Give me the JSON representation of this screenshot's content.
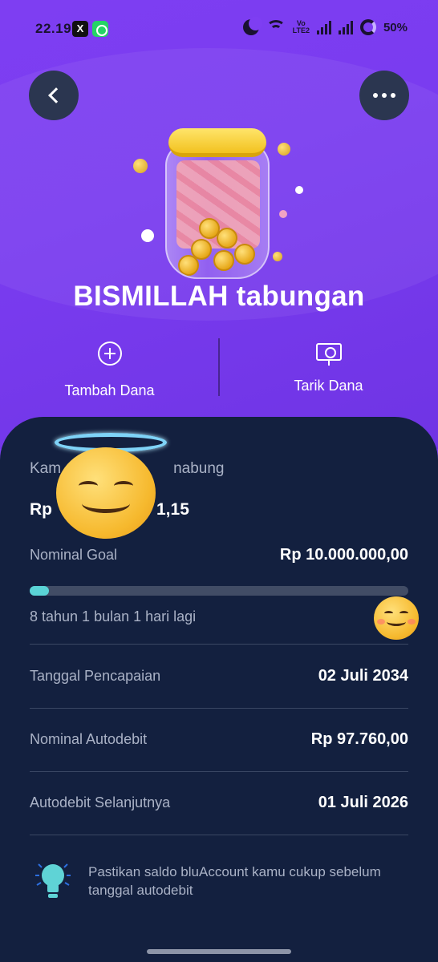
{
  "status_bar": {
    "time": "22.19",
    "app_icons": [
      "x-icon",
      "whatsapp-icon"
    ],
    "network_label_top": "Vo",
    "network_label_bottom": "LTE2",
    "battery": "50%"
  },
  "header": {
    "back_icon": "chevron-left-icon",
    "more_icon": "more-horizontal-icon",
    "jar_illustration": "savings-jar-icon",
    "title": "BISMILLAH tabungan"
  },
  "actions": [
    {
      "label": "Tambah Dana",
      "icon": "plus-circle-icon"
    },
    {
      "label": "Tarik Dana",
      "icon": "cash-withdraw-icon"
    }
  ],
  "card": {
    "saved_label_visible_start": "Kam",
    "saved_label_visible_end": "nabung",
    "saved_value_visible_start": "Rp",
    "saved_value_visible_end": "1,15",
    "goal_label": "Nominal Goal",
    "goal_value": "Rp 10.000.000,00",
    "progress_percent": 5,
    "remaining_text": "8 tahun 1 bulan 1 hari lagi",
    "details": [
      {
        "label": "Tanggal Pencapaian",
        "value": "02 Juli 2034"
      },
      {
        "label": "Nominal Autodebit",
        "value": "Rp 97.760,00"
      },
      {
        "label": "Autodebit Selanjutnya",
        "value": "01 Juli 2026"
      }
    ],
    "tip_icon": "lightbulb-icon",
    "tip_text": "Pastikan saldo bluAccount kamu cukup sebelum tanggal autodebit"
  },
  "stickers": [
    "smiling-face-with-halo-emoji",
    "smiling-face-emoji"
  ],
  "colors": {
    "header_bg": "#7e3ef2",
    "card_bg": "#13203f",
    "progress_fill": "#5ad3d6",
    "button_bg": "#2b3650"
  }
}
